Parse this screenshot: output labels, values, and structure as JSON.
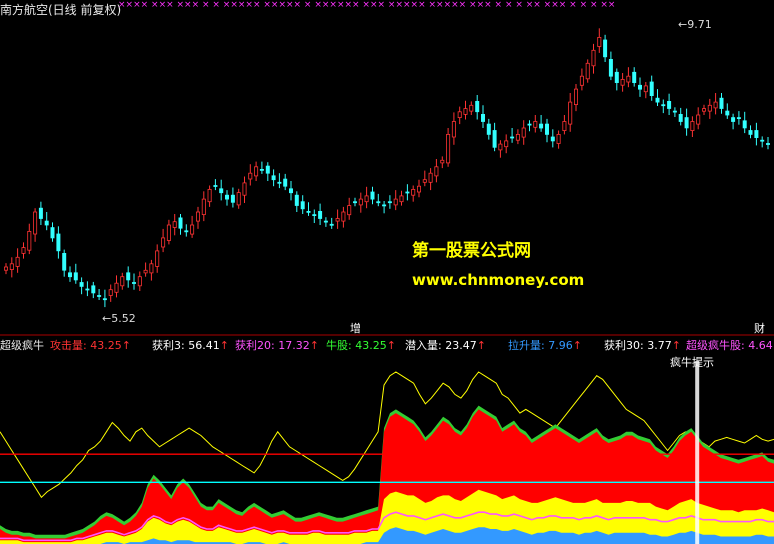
{
  "header": {
    "title": "南方航空(日线 前复权)",
    "top_marks": "××××  ×××    ×××   ×  ×  ×××××  ×××××  ×   ××××××  ×××   ×××××   ×××××  ×××   ×   ×    ×     ××  ×××   ×  ×  ×  ××"
  },
  "price_panel": {
    "high_label": "9.71",
    "low_label": "5.52",
    "watermark_1": "第一股票公式网",
    "watermark_2": "www.chnmoney.com",
    "marker_left": "增",
    "marker_right": "财"
  },
  "indicator_header": {
    "name": "超级疯牛",
    "items": [
      {
        "label": "攻击量:",
        "value": "43.25",
        "color": "#ff3333"
      },
      {
        "label": "获利3:",
        "value": "56.41",
        "color": "#ffffff"
      },
      {
        "label": "获利20:",
        "value": "17.32",
        "color": "#ff55ff"
      },
      {
        "label": "牛股:",
        "value": "43.25",
        "color": "#33ff33"
      },
      {
        "label": "潜入量:",
        "value": "23.47",
        "color": "#ffffff"
      },
      {
        "label": "拉升量:",
        "value": "7.96",
        "color": "#3399ff"
      },
      {
        "label": "获利30:",
        "value": "3.77",
        "color": "#ffffff"
      },
      {
        "label": "超级疯牛股:",
        "value": "4.64",
        "color": "#ff55ff"
      }
    ],
    "hint": "疯牛提示"
  },
  "chart_data": [
    {
      "type": "candlestick",
      "title": "南方航空(日线 前复权)",
      "ylim": [
        5.2,
        9.9
      ],
      "annotations": [
        {
          "text": "9.71",
          "x": 118,
          "y": 9.71
        },
        {
          "text": "5.52",
          "x": 17,
          "y": 5.52
        }
      ],
      "x": [
        0,
        1,
        2,
        3,
        4,
        5,
        6,
        7,
        8,
        9,
        10,
        11,
        12,
        13,
        14,
        15,
        16,
        17,
        18,
        19,
        20,
        21,
        22,
        23,
        24,
        25,
        26,
        27,
        28,
        29,
        30,
        31,
        32,
        33,
        34,
        35,
        36,
        37,
        38,
        39,
        40,
        41,
        42,
        43,
        44,
        45,
        46,
        47,
        48,
        49,
        50,
        51,
        52,
        53,
        54,
        55,
        56,
        57,
        58,
        59,
        60,
        61,
        62,
        63,
        64,
        65,
        66,
        67,
        68,
        69,
        70,
        71,
        72,
        73,
        74,
        75,
        76,
        77,
        78,
        79,
        80,
        81,
        82,
        83,
        84,
        85,
        86,
        87,
        88,
        89,
        90,
        91,
        92,
        93,
        94,
        95,
        96,
        97,
        98,
        99,
        100,
        101,
        102,
        103,
        104,
        105,
        106,
        107,
        108,
        109,
        110,
        111,
        112,
        113,
        114,
        115,
        116,
        117,
        118,
        119,
        120,
        121,
        122,
        123,
        124,
        125,
        126,
        127,
        128,
        129,
        130,
        131
      ],
      "close": [
        6.05,
        6.1,
        6.2,
        6.35,
        6.6,
        6.9,
        6.8,
        6.7,
        6.5,
        6.3,
        6.0,
        5.9,
        5.85,
        5.75,
        5.7,
        5.65,
        5.6,
        5.55,
        5.7,
        5.8,
        5.9,
        5.85,
        5.8,
        5.9,
        6.0,
        6.1,
        6.3,
        6.5,
        6.7,
        6.75,
        6.65,
        6.6,
        6.7,
        6.9,
        7.1,
        7.25,
        7.3,
        7.2,
        7.1,
        7.05,
        7.2,
        7.35,
        7.5,
        7.6,
        7.55,
        7.5,
        7.4,
        7.35,
        7.3,
        7.2,
        7.0,
        6.95,
        6.9,
        6.85,
        6.8,
        6.75,
        6.7,
        6.8,
        6.9,
        7.0,
        7.05,
        7.1,
        7.15,
        7.1,
        7.05,
        7.0,
        7.05,
        7.1,
        7.15,
        7.2,
        7.25,
        7.3,
        7.4,
        7.5,
        7.6,
        7.7,
        8.1,
        8.3,
        8.45,
        8.5,
        8.55,
        8.45,
        8.3,
        8.1,
        7.9,
        7.95,
        8.0,
        8.05,
        8.1,
        8.2,
        8.25,
        8.3,
        8.2,
        8.1,
        8.0,
        8.1,
        8.3,
        8.6,
        8.8,
        9.0,
        9.2,
        9.4,
        9.6,
        9.3,
        9.0,
        8.9,
        8.95,
        9.0,
        8.9,
        8.8,
        8.85,
        8.7,
        8.6,
        8.55,
        8.5,
        8.45,
        8.3,
        8.2,
        8.3,
        8.4,
        8.5,
        8.55,
        8.6,
        8.5,
        8.4,
        8.3,
        8.35,
        8.2,
        8.1,
        8.05,
        8.0,
        7.95
      ]
    },
    {
      "type": "area",
      "title": "超级疯牛",
      "ylim": [
        0,
        100
      ],
      "series": [
        {
          "name": "攻击量",
          "color": "#ff0000",
          "values": [
            8,
            6,
            5,
            5,
            4,
            4,
            3,
            3,
            3,
            3,
            3,
            3,
            4,
            5,
            6,
            8,
            10,
            13,
            15,
            14,
            12,
            10,
            12,
            15,
            20,
            30,
            35,
            32,
            28,
            24,
            30,
            33,
            30,
            25,
            20,
            18,
            18,
            22,
            20,
            18,
            16,
            15,
            18,
            20,
            18,
            16,
            14,
            15,
            16,
            14,
            12,
            12,
            13,
            14,
            15,
            14,
            13,
            12,
            12,
            13,
            14,
            15,
            16,
            17,
            18,
            60,
            68,
            70,
            68,
            66,
            64,
            60,
            55,
            58,
            62,
            66,
            64,
            60,
            58,
            62,
            68,
            72,
            70,
            68,
            66,
            60,
            62,
            64,
            60,
            58,
            54,
            56,
            58,
            60,
            62,
            60,
            58,
            56,
            54,
            56,
            58,
            60,
            56,
            54,
            55,
            56,
            58,
            58,
            56,
            55,
            54,
            50,
            48,
            46,
            50,
            55,
            58,
            60,
            56,
            52,
            50,
            48,
            46,
            45,
            44,
            43,
            44,
            45,
            46,
            47,
            44,
            43
          ]
        },
        {
          "name": "获利3",
          "color": "#ffff00",
          "values": [
            60,
            55,
            50,
            45,
            40,
            35,
            30,
            25,
            28,
            30,
            32,
            35,
            38,
            42,
            45,
            50,
            52,
            55,
            60,
            65,
            62,
            58,
            55,
            60,
            62,
            58,
            55,
            52,
            54,
            56,
            58,
            60,
            62,
            60,
            58,
            55,
            52,
            50,
            48,
            46,
            44,
            42,
            40,
            38,
            42,
            48,
            55,
            60,
            56,
            52,
            50,
            48,
            46,
            44,
            42,
            40,
            38,
            36,
            34,
            36,
            40,
            45,
            50,
            55,
            60,
            85,
            90,
            92,
            90,
            88,
            86,
            80,
            75,
            78,
            82,
            86,
            84,
            80,
            78,
            82,
            88,
            92,
            90,
            88,
            86,
            80,
            78,
            74,
            70,
            72,
            70,
            68,
            66,
            64,
            62,
            66,
            70,
            74,
            78,
            82,
            86,
            90,
            88,
            84,
            80,
            76,
            72,
            70,
            68,
            66,
            62,
            58,
            54,
            50,
            54,
            58,
            60,
            58,
            56,
            54,
            52,
            55,
            56,
            57,
            56,
            55,
            54,
            56,
            58,
            56,
            55,
            56
          ]
        },
        {
          "name": "牛股",
          "color": "#33cc33",
          "values": [
            10,
            8,
            7,
            7,
            6,
            6,
            5,
            5,
            5,
            5,
            5,
            5,
            6,
            7,
            8,
            10,
            12,
            15,
            17,
            16,
            14,
            12,
            14,
            17,
            22,
            32,
            37,
            34,
            30,
            26,
            32,
            35,
            32,
            27,
            22,
            20,
            20,
            24,
            22,
            20,
            18,
            17,
            20,
            22,
            20,
            18,
            16,
            17,
            18,
            16,
            14,
            14,
            15,
            16,
            17,
            16,
            15,
            14,
            14,
            15,
            16,
            17,
            18,
            19,
            20,
            62,
            70,
            72,
            70,
            68,
            66,
            62,
            57,
            60,
            64,
            68,
            66,
            62,
            60,
            64,
            70,
            74,
            72,
            70,
            68,
            62,
            64,
            66,
            62,
            60,
            56,
            58,
            60,
            62,
            64,
            62,
            60,
            58,
            56,
            58,
            60,
            62,
            58,
            56,
            57,
            58,
            60,
            60,
            58,
            57,
            56,
            52,
            50,
            48,
            52,
            57,
            60,
            62,
            58,
            54,
            52,
            50,
            48,
            47,
            46,
            45,
            46,
            47,
            48,
            49,
            46,
            45
          ]
        },
        {
          "name": "潜入量",
          "color": "#ffff00",
          "values": [
            2,
            2,
            2,
            2,
            1,
            1,
            1,
            1,
            1,
            1,
            1,
            1,
            1,
            2,
            2,
            3,
            4,
            5,
            6,
            6,
            5,
            4,
            5,
            6,
            8,
            12,
            14,
            13,
            11,
            10,
            12,
            13,
            12,
            10,
            8,
            7,
            7,
            9,
            8,
            7,
            6,
            6,
            7,
            8,
            7,
            6,
            5,
            6,
            6,
            5,
            5,
            5,
            5,
            6,
            6,
            5,
            5,
            5,
            5,
            5,
            6,
            6,
            6,
            7,
            7,
            24,
            27,
            28,
            27,
            26,
            26,
            24,
            22,
            23,
            25,
            26,
            26,
            24,
            23,
            25,
            27,
            29,
            28,
            27,
            26,
            24,
            25,
            26,
            24,
            23,
            22,
            22,
            23,
            24,
            25,
            24,
            23,
            22,
            22,
            22,
            23,
            24,
            22,
            22,
            22,
            22,
            23,
            23,
            22,
            22,
            22,
            20,
            19,
            18,
            20,
            22,
            23,
            24,
            22,
            21,
            20,
            19,
            18,
            18,
            18,
            17,
            18,
            18,
            18,
            19,
            18,
            17
          ]
        },
        {
          "name": "拉升量",
          "color": "#3399ff",
          "values": [
            0,
            0,
            0,
            0,
            0,
            0,
            0,
            0,
            0,
            0,
            0,
            0,
            0,
            0,
            0,
            0,
            0,
            0,
            1,
            1,
            1,
            0,
            1,
            1,
            1,
            2,
            3,
            2,
            2,
            1,
            2,
            2,
            2,
            1,
            1,
            1,
            1,
            1,
            1,
            1,
            0,
            0,
            1,
            1,
            1,
            0,
            0,
            0,
            1,
            0,
            0,
            0,
            0,
            0,
            0,
            0,
            0,
            0,
            0,
            0,
            0,
            0,
            1,
            1,
            1,
            6,
            8,
            9,
            8,
            7,
            7,
            6,
            5,
            6,
            7,
            8,
            7,
            6,
            6,
            7,
            8,
            9,
            9,
            8,
            8,
            7,
            7,
            8,
            7,
            6,
            5,
            6,
            6,
            7,
            7,
            6,
            6,
            6,
            5,
            6,
            6,
            7,
            6,
            5,
            6,
            6,
            6,
            6,
            6,
            6,
            5,
            5,
            4,
            4,
            5,
            6,
            6,
            7,
            6,
            5,
            5,
            5,
            4,
            4,
            4,
            4,
            4,
            4,
            5,
            5,
            4,
            4
          ]
        },
        {
          "name": "获利20",
          "color": "#ff55ff",
          "values": [
            3,
            3,
            3,
            3,
            2,
            2,
            2,
            2,
            2,
            2,
            2,
            2,
            2,
            3,
            3,
            4,
            5,
            6,
            7,
            7,
            6,
            5,
            6,
            7,
            9,
            13,
            15,
            14,
            12,
            11,
            13,
            14,
            13,
            11,
            9,
            8,
            8,
            10,
            9,
            8,
            7,
            7,
            8,
            9,
            8,
            7,
            6,
            7,
            7,
            6,
            6,
            6,
            6,
            7,
            7,
            6,
            6,
            6,
            6,
            6,
            7,
            7,
            7,
            8,
            8,
            14,
            16,
            17,
            16,
            15,
            15,
            14,
            13,
            14,
            15,
            16,
            15,
            14,
            14,
            15,
            16,
            17,
            17,
            16,
            16,
            15,
            15,
            16,
            15,
            14,
            13,
            14,
            14,
            15,
            15,
            14,
            14,
            14,
            13,
            14,
            14,
            15,
            14,
            13,
            14,
            14,
            14,
            14,
            14,
            14,
            13,
            13,
            12,
            12,
            13,
            14,
            14,
            15,
            14,
            13,
            13,
            13,
            12,
            12,
            12,
            12,
            12,
            12,
            13,
            13,
            12,
            12
          ]
        }
      ],
      "reference_lines": [
        {
          "y": 48,
          "color": "#ff0000"
        },
        {
          "y": 33,
          "color": "#00ffff"
        }
      ],
      "annotations": [
        {
          "text": "疯牛提示",
          "x": 118
        }
      ]
    }
  ]
}
